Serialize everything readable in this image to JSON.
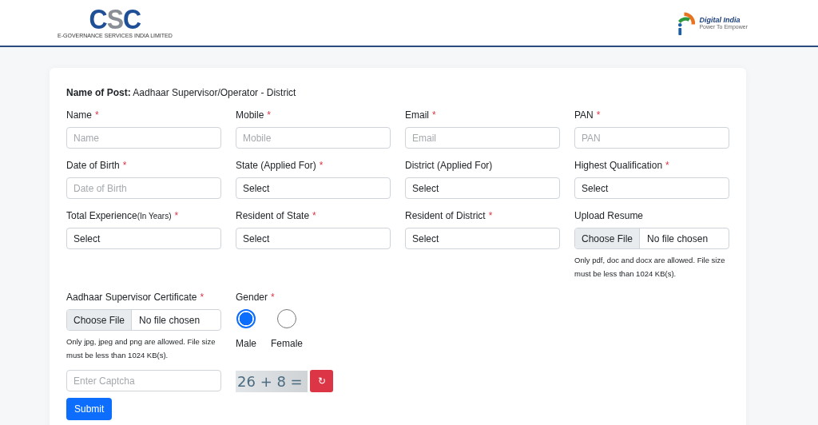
{
  "header": {
    "csc_logo": {
      "letters": [
        "C",
        "S",
        "C"
      ],
      "tagline": "E-GOVERNANCE SERVICES INDIA LIMITED"
    },
    "di_logo": {
      "name": "Digital India",
      "tagline": "Power To Empower"
    }
  },
  "form": {
    "post_label": "Name of Post:",
    "post_value": "Aadhaar Supervisor/Operator - District",
    "fields": [
      {
        "label": "Name",
        "star": "*",
        "kind": "text",
        "placeholder": "Name"
      },
      {
        "label": "Mobile",
        "star": "*",
        "kind": "text",
        "placeholder": "Mobile"
      },
      {
        "label": "Email",
        "star": "*",
        "kind": "text",
        "placeholder": "Email"
      },
      {
        "label": "PAN",
        "star": "*",
        "kind": "text",
        "placeholder": "PAN"
      },
      {
        "label": "Date of Birth",
        "star": "*",
        "kind": "text",
        "placeholder": "Date of Birth"
      },
      {
        "label": "State (Applied For)",
        "star": "*",
        "kind": "select",
        "value": "Select"
      },
      {
        "label": "District (Applied For)",
        "kind": "select",
        "value": "Select"
      },
      {
        "label": "Highest Qualification",
        "star": "*",
        "kind": "select",
        "value": "Select"
      },
      {
        "label": "Total Experience",
        "note": "(In Years)",
        "star": "*",
        "kind": "select",
        "value": "Select"
      },
      {
        "label": "Resident of State",
        "star": "*",
        "kind": "select",
        "value": "Select"
      },
      {
        "label": "Resident of District",
        "star": "*",
        "kind": "select",
        "value": "Select"
      },
      {
        "label": "Upload Resume",
        "kind": "file",
        "button": "Choose File",
        "value": "No file chosen",
        "help": "Only pdf, doc and docx are allowed. File size must be less than 1024 KB(s)."
      },
      {
        "label": "Aadhaar Supervisor Certificate",
        "star": "*",
        "kind": "file",
        "button": "Choose File",
        "value": "No file chosen",
        "help": "Only jpg, jpeg and png are allowed. File size must be less than 1024 KB(s)."
      },
      {
        "label": "Gender",
        "star": "*",
        "kind": "radio",
        "options": [
          {
            "label": "Male",
            "selected": true
          },
          {
            "label": "Female",
            "selected": false
          }
        ]
      }
    ],
    "captcha": {
      "placeholder": "Enter Captcha",
      "text": "26 + 8 =",
      "refresh": "↻"
    },
    "submit": "Submit"
  }
}
